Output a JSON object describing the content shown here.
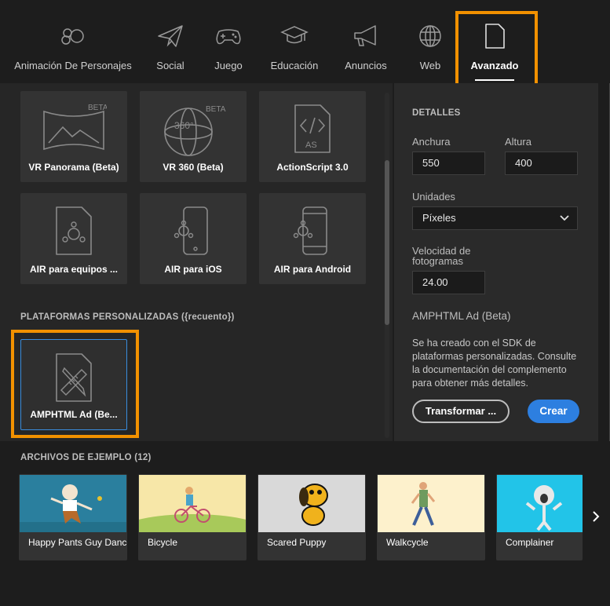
{
  "categories": [
    {
      "label": "Animación De Personajes",
      "icon": "character-animation-icon"
    },
    {
      "label": "Social",
      "icon": "paper-plane-icon"
    },
    {
      "label": "Juego",
      "icon": "gamepad-icon"
    },
    {
      "label": "Educación",
      "icon": "graduation-cap-icon"
    },
    {
      "label": "Anuncios",
      "icon": "megaphone-icon"
    },
    {
      "label": "Web",
      "icon": "globe-icon"
    },
    {
      "label": "Avanzado",
      "icon": "document-icon"
    }
  ],
  "active_category": "Avanzado",
  "templates": [
    {
      "label": "VR Panorama (Beta)",
      "badge": "BETA"
    },
    {
      "label": "VR 360 (Beta)",
      "badge": "BETA",
      "sub": "360°"
    },
    {
      "label": "ActionScript 3.0",
      "sub": "AS"
    },
    {
      "label": "AIR para equipos ..."
    },
    {
      "label": "AIR para iOS"
    },
    {
      "label": "AIR para Android"
    }
  ],
  "custom_platforms": {
    "heading": "PLATAFORMAS PERSONALIZADAS ({recuento})",
    "items": [
      {
        "label": "AMPHTML Ad (Be..."
      }
    ]
  },
  "details": {
    "heading": "DETALLES",
    "width_label": "Anchura",
    "width_value": "550",
    "height_label": "Altura",
    "height_value": "400",
    "units_label": "Unidades",
    "units_value": "Píxeles",
    "fps_label": "Velocidad de fotogramas",
    "fps_value": "24.00",
    "template_name": "AMPHTML Ad (Beta)",
    "description": "Se ha creado con el SDK de plataformas personalizadas. Consulte la documentación del complemento para obtener más detalles.",
    "transform_label": "Transformar ...",
    "create_label": "Crear"
  },
  "samples": {
    "heading": "ARCHIVOS DE EJEMPLO (12)",
    "items": [
      {
        "label": "Happy Pants Guy Dance"
      },
      {
        "label": "Bicycle"
      },
      {
        "label": "Scared Puppy"
      },
      {
        "label": "Walkcycle"
      },
      {
        "label": "Complainer"
      }
    ]
  },
  "colors": {
    "highlight": "#f29100",
    "accent": "#2d7fe0",
    "selection": "#3a8ddd"
  }
}
